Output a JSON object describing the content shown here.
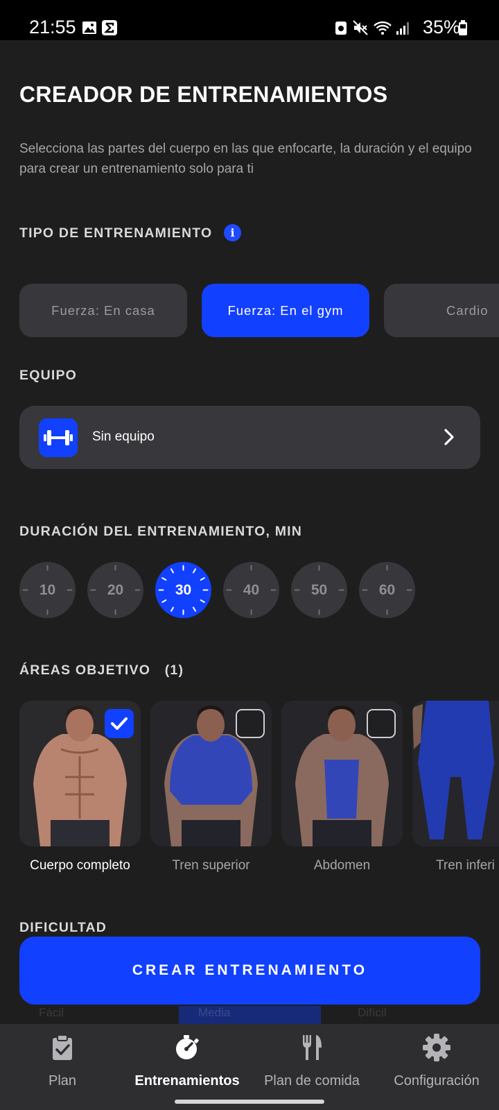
{
  "status_bar": {
    "time": "21:55",
    "battery_percent": "35%",
    "icons": [
      "image-icon",
      "sigma-icon",
      "battery-saver-icon",
      "mute-icon",
      "wifi-icon",
      "signal-icon",
      "battery-icon"
    ]
  },
  "header": {
    "title": "CREADOR DE ENTRENAMIENTOS",
    "subtitle": "Selecciona las partes del cuerpo en las que enfocarte, la duración y el equipo para crear un entrenamiento solo para ti"
  },
  "workout_type": {
    "label": "TIPO DE ENTRENAMIENTO",
    "info_icon": "i",
    "options": [
      {
        "label": "Fuerza: En casa",
        "active": false
      },
      {
        "label": "Fuerza: En el gym",
        "active": true
      },
      {
        "label": "Cardio",
        "active": false
      }
    ]
  },
  "equipment": {
    "label": "EQUIPO",
    "value": "Sin equipo",
    "icon": "dumbbell-icon"
  },
  "duration": {
    "label": "DURACIÓN DEL ENTRENAMIENTO, MIN",
    "options": [
      "10",
      "20",
      "30",
      "40",
      "50",
      "60"
    ],
    "selected": "30"
  },
  "target_areas": {
    "label": "ÁREAS OBJETIVO",
    "count": "(1)",
    "items": [
      {
        "label": "Cuerpo completo",
        "selected": true
      },
      {
        "label": "Tren superior",
        "selected": false
      },
      {
        "label": "Abdomen",
        "selected": false
      },
      {
        "label": "Tren inferi",
        "selected": false
      }
    ]
  },
  "difficulty": {
    "label": "DIFICULTAD",
    "partial_options": [
      "Fácil",
      "Media",
      "Difícil"
    ]
  },
  "cta": {
    "label": "CREAR ENTRENAMIENTO"
  },
  "nav": {
    "items": [
      {
        "label": "Plan",
        "icon": "clipboard-icon",
        "active": false
      },
      {
        "label": "Entrenamientos",
        "icon": "stopwatch-icon",
        "active": true
      },
      {
        "label": "Plan de comida",
        "icon": "fork-knife-icon",
        "active": false
      },
      {
        "label": "Configuración",
        "icon": "gear-icon",
        "active": false
      }
    ]
  },
  "colors": {
    "background": "#1e1e1f",
    "accent": "#1240ff",
    "card": "#38383c",
    "nav_bg": "#2e2e31"
  }
}
